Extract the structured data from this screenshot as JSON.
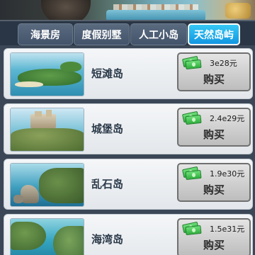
{
  "tabs": [
    {
      "label": "海景房",
      "active": false
    },
    {
      "label": "度假别墅",
      "active": false
    },
    {
      "label": "人工小岛",
      "active": false
    },
    {
      "label": "天然岛屿",
      "active": true
    }
  ],
  "items": [
    {
      "name": "短滩岛",
      "price": "3e28元",
      "buy_label": "购买"
    },
    {
      "name": "城堡岛",
      "price": "2.4e29元",
      "buy_label": "购买"
    },
    {
      "name": "乱石岛",
      "price": "1.9e30元",
      "buy_label": "购买"
    },
    {
      "name": "海湾岛",
      "price": "1.5e31元",
      "buy_label": "购买"
    }
  ],
  "colors": {
    "active_tab": "#1cabea",
    "tab": "#4d5e75",
    "buy_button": "#cfcfcf",
    "money": "#3cbf49"
  },
  "icons": {
    "price_icon": "money-stack-icon"
  }
}
